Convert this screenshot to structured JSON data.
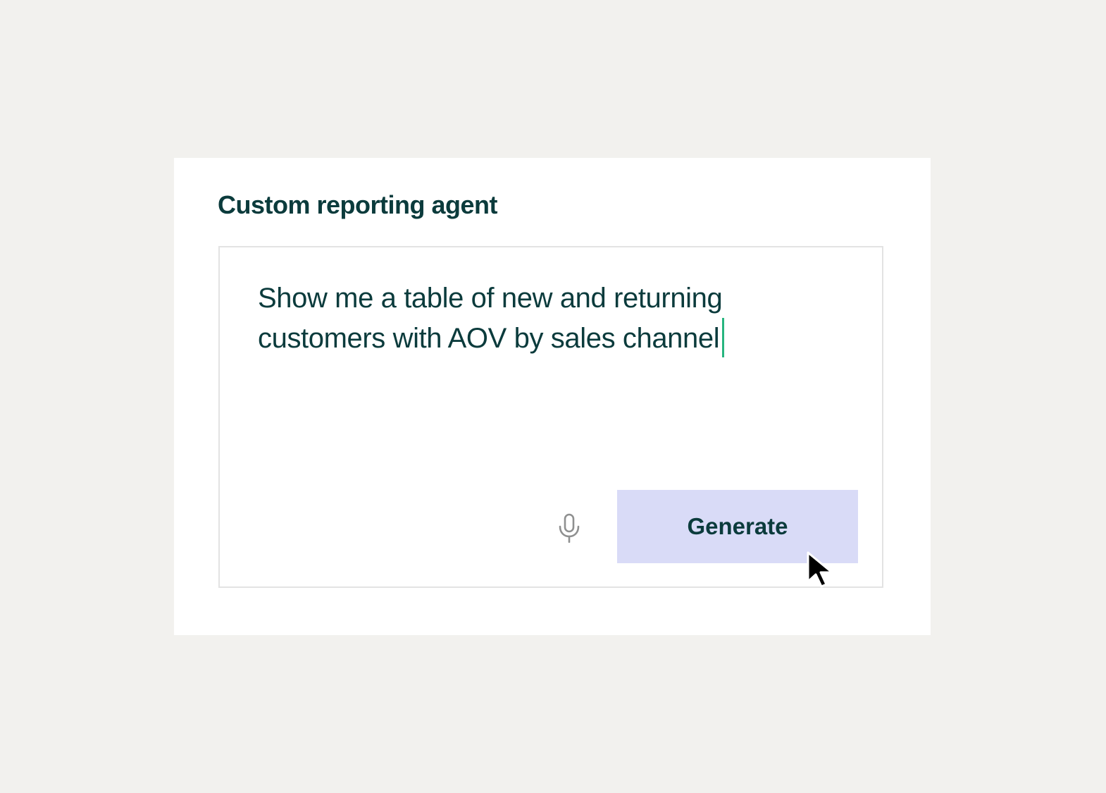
{
  "card": {
    "title": "Custom reporting agent"
  },
  "prompt": {
    "line1": "Show me a table of new and returning",
    "line2": "customers with AOV by sales channel"
  },
  "actions": {
    "mic_icon": "microphone-icon",
    "generate_label": "Generate"
  },
  "colors": {
    "background": "#f2f1ee",
    "card": "#ffffff",
    "text": "#0b3b3c",
    "button": "#d9dbf7",
    "caret": "#27b57f"
  }
}
